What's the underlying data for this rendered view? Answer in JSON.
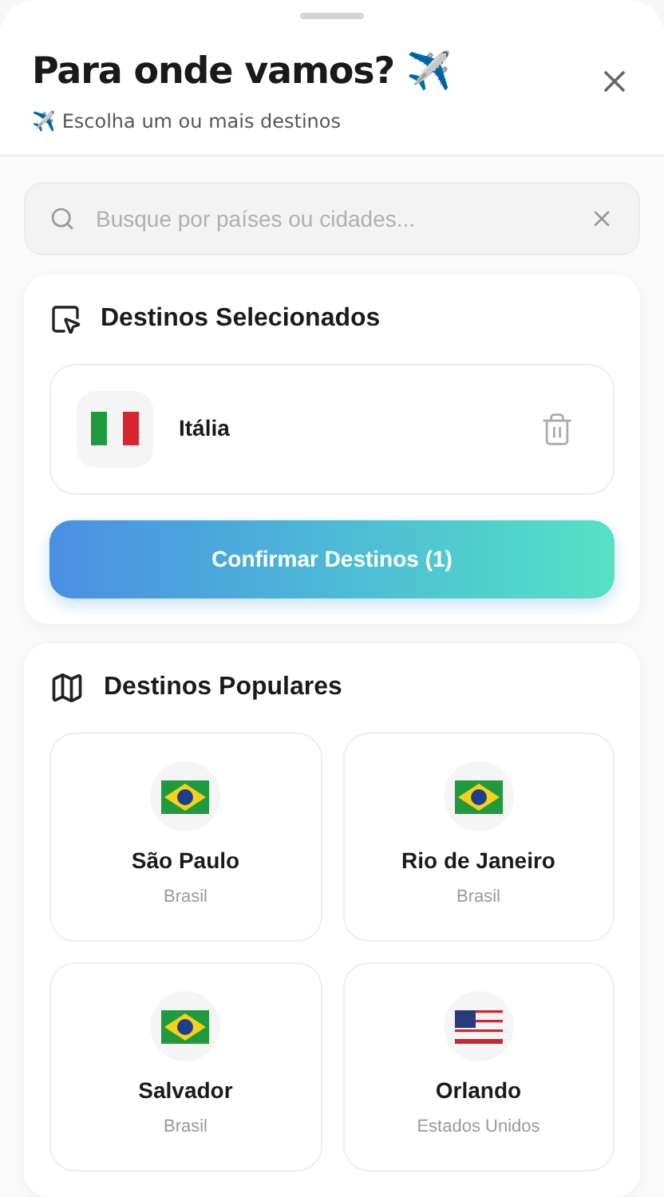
{
  "header": {
    "title": "Para onde vamos? ✈️",
    "subtitle": "✈️ Escolha um ou mais destinos"
  },
  "search": {
    "placeholder": "Busque por países ou cidades..."
  },
  "selected_section": {
    "title": "Destinos Selecionados",
    "items": [
      {
        "name": "Itália",
        "kind": "italy"
      }
    ],
    "confirm_button": "Confirmar Destinos (1)"
  },
  "popular_section": {
    "title": "Destinos Populares",
    "items": [
      {
        "city": "São Paulo",
        "country": "Brasil",
        "kind": "brazil"
      },
      {
        "city": "Rio de Janeiro",
        "country": "Brasil",
        "kind": "brazil"
      },
      {
        "city": "Salvador",
        "country": "Brasil",
        "kind": "brazil"
      },
      {
        "city": "Orlando",
        "country": "Estados Unidos",
        "kind": "usa"
      }
    ]
  }
}
